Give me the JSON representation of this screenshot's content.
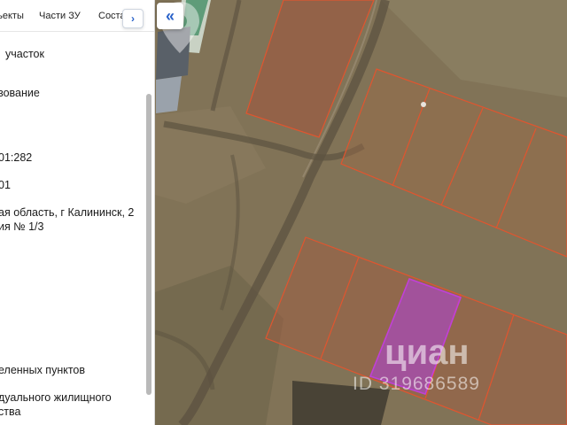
{
  "tabs": {
    "items": [
      "ъекты",
      "Части ЗУ",
      "Соста"
    ],
    "next_icon": "chevron-right-icon"
  },
  "panel": {
    "fields": [
      "участок",
      "зование",
      "01:282",
      "01",
      "ая область, г Калининск, 2",
      "ия № 1/3",
      "еленных пунктов",
      "дуального жилищного",
      "ства"
    ]
  },
  "map": {
    "collapse_icon": "double-chevron-left-icon",
    "watermark_brand": "циан",
    "watermark_id": "ID 319686589",
    "colors": {
      "parcel_border": "#e0552f",
      "selected_fill": "#a84bb6",
      "selected_border": "#c040d8",
      "accent": "#2a62c9"
    }
  }
}
